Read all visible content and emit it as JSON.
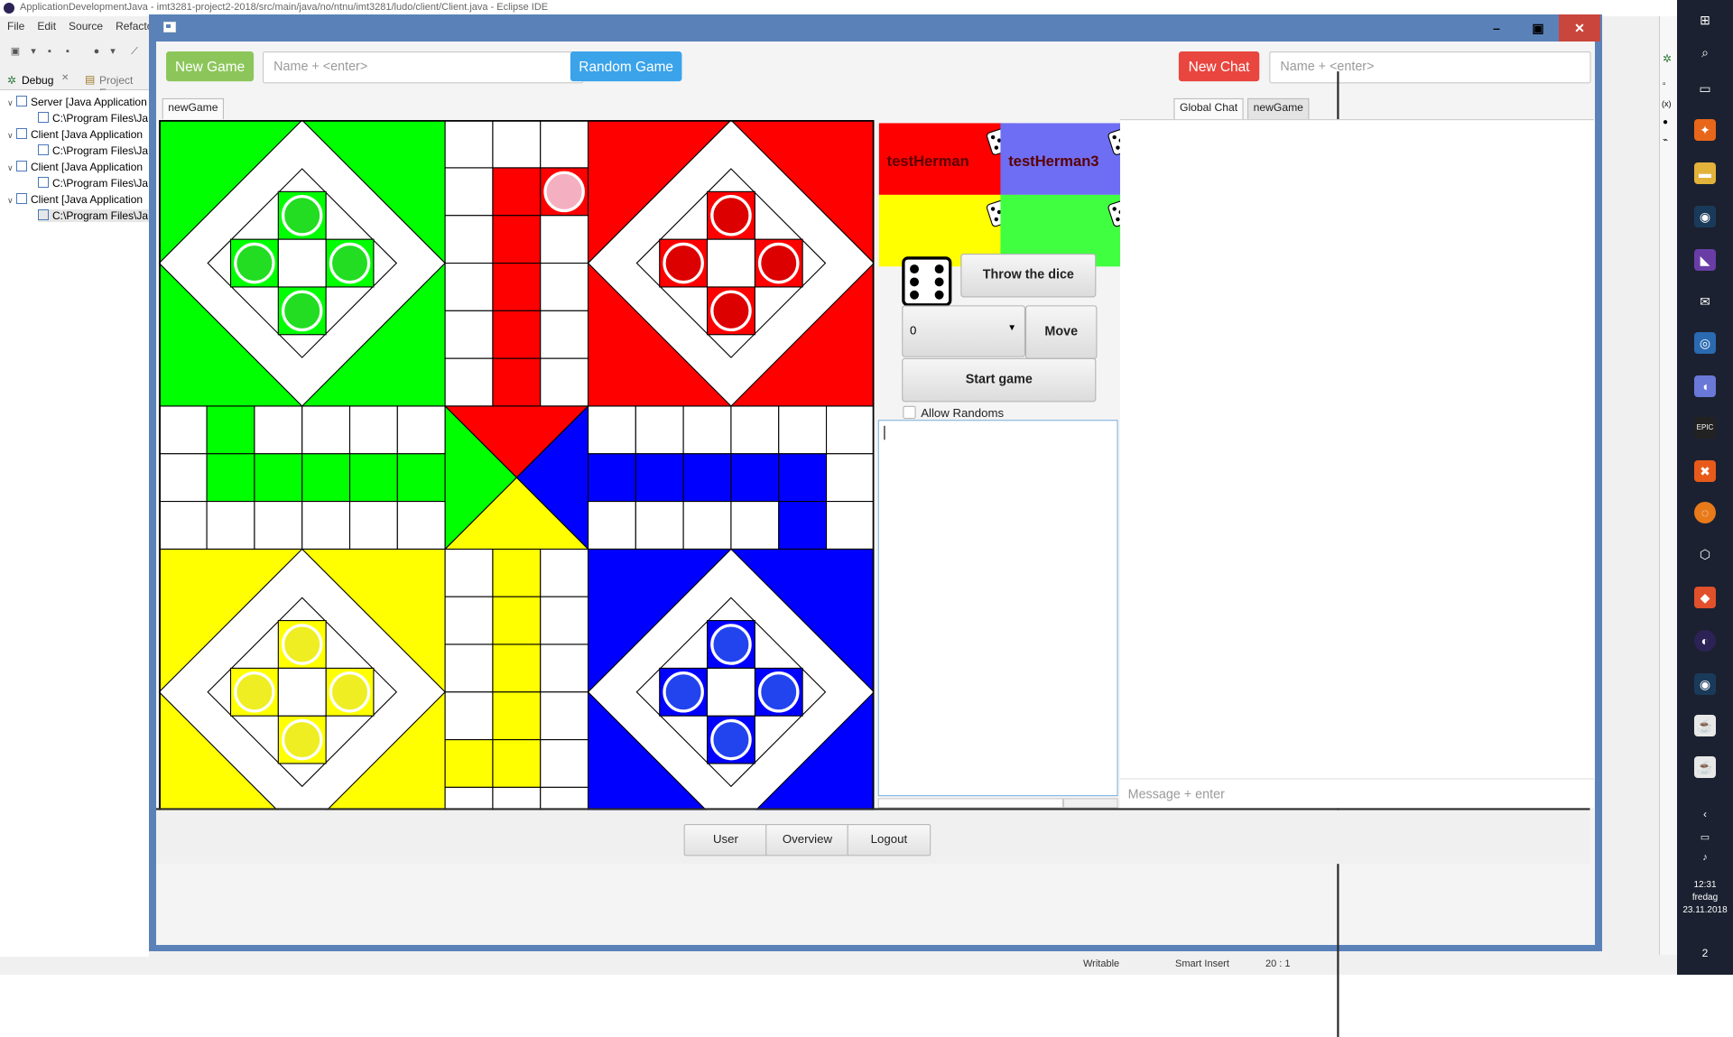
{
  "eclipse": {
    "title": "ApplicationDevelopmentJava - imt3281-project2-2018/src/main/java/no/ntnu/imt3281/ludo/client/Client.java - Eclipse IDE",
    "menu": [
      "File",
      "Edit",
      "Source",
      "Refacto"
    ],
    "tabs": {
      "debug": "Debug",
      "project": "Project Exp"
    },
    "tree": [
      {
        "label": "Server [Java Application",
        "level": 0
      },
      {
        "label": "C:\\Program Files\\Ja",
        "level": 1
      },
      {
        "label": "Client [Java Application",
        "level": 0
      },
      {
        "label": "C:\\Program Files\\Ja",
        "level": 1
      },
      {
        "label": "Client [Java Application",
        "level": 0
      },
      {
        "label": "C:\\Program Files\\Ja",
        "level": 1
      },
      {
        "label": "Client [Java Application",
        "level": 0
      },
      {
        "label": "C:\\Program Files\\Ja",
        "level": 1
      }
    ],
    "status": {
      "writable": "Writable",
      "insert": "Smart Insert",
      "position": "20 : 1"
    }
  },
  "taskbar": {
    "clock_time": "12:31",
    "clock_day": "fredag",
    "clock_date": "23.11.2018",
    "notifications": "2"
  },
  "top_left": {
    "new_game": "New Game",
    "name_placeholder": "Name + <enter>",
    "random_game": "Random Game",
    "tab": "newGame"
  },
  "top_right": {
    "new_chat": "New Chat",
    "name_placeholder": "Name + <enter>",
    "tabs": [
      "Global Chat",
      "newGame"
    ]
  },
  "players": [
    {
      "name": "testHerman",
      "color": "#ff0000"
    },
    {
      "name": "testHerman3",
      "color": "#6e6ef5"
    },
    {
      "name": "",
      "color": "#ffff00"
    },
    {
      "name": "",
      "color": "#40ff40"
    }
  ],
  "controls": {
    "dice_value": 6,
    "throw_label": "Throw the dice",
    "move_select_value": "0",
    "move_label": "Move",
    "start_label": "Start game",
    "allow_randoms_label": "Allow Randoms",
    "allow_randoms_checked": false
  },
  "chat": {
    "message_placeholder": "Message + enter"
  },
  "bottom": {
    "user": "User",
    "overview": "Overview",
    "logout": "Logout"
  },
  "colors": {
    "green": "#00ff00",
    "red": "#ff0000",
    "yellow": "#ffff00",
    "blue": "#0000ff",
    "token_green": "#22dd22",
    "token_red": "#dd0000",
    "token_yellow": "#eeee22",
    "token_blue": "#2244ee",
    "token_pink": "#f4b0c0",
    "new_game_btn": "#8cc65a",
    "random_game_btn": "#3aa3ea",
    "new_chat_btn": "#e8463f"
  },
  "board": {
    "grid_size": 15,
    "pink_token_cell": [
      8,
      1
    ]
  }
}
